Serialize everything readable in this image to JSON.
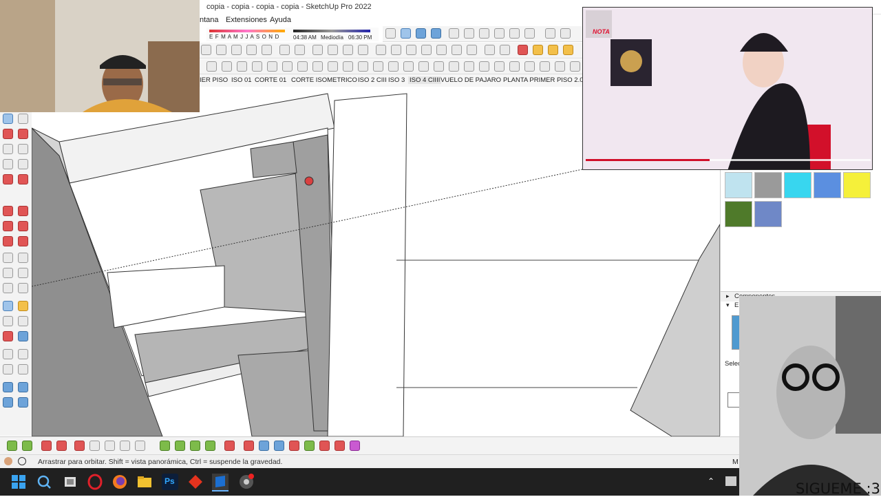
{
  "window": {
    "title": "copia - copia - copia - copia - SketchUp Pro 2022",
    "menus": [
      "ntana",
      "Extensiones",
      "Ayuda"
    ]
  },
  "shadow_bar": {
    "months": "E F M A M J J A S O N D",
    "time": "04:38 AM",
    "noon": "Mediodía",
    "end_time": "06:30 PM"
  },
  "scene_tabs": [
    "IER PISO",
    "ISO 01",
    "CORTE 01",
    "CORTE ISOMETRICO",
    "ISO 2 CIII",
    "ISO 3",
    "ISO 4 CIIII",
    "VUELO DE PAJARO",
    "PLANTA PRIMER PISO 2.0"
  ],
  "active_scene": "ISO 4 CIIII",
  "status": {
    "message": "Arrastrar para orbitar. Shift = vista panorámica, Ctrl = suspende la gravedad.",
    "right_label": "M"
  },
  "right_panel": {
    "components_label": "Componentes",
    "select_label": "Selec",
    "tray_marker": "E",
    "swatches": [
      {
        "name": "water-pattern",
        "color": "#bfe3ef"
      },
      {
        "name": "gray",
        "color": "#9a9a9a"
      },
      {
        "name": "cyan",
        "color": "#38d6ef"
      },
      {
        "name": "blue",
        "color": "#5b8fe0"
      },
      {
        "name": "yellow",
        "color": "#f5f03a"
      },
      {
        "name": "dark-green",
        "color": "#4f7a2a"
      },
      {
        "name": "blue-marble",
        "color": "#6f88c7"
      }
    ]
  },
  "overlays": {
    "nota_label": "NOTA",
    "follow_text": "SIGUEME :3"
  },
  "taskbar": {
    "apps": [
      "windows-start-icon",
      "search-icon",
      "task-view-icon",
      "opera-icon",
      "firefox-icon",
      "file-explorer-icon",
      "photoshop-icon",
      "red-app-icon",
      "sketchup-icon",
      "chrome-icon"
    ],
    "photoshop_label": "Ps"
  }
}
